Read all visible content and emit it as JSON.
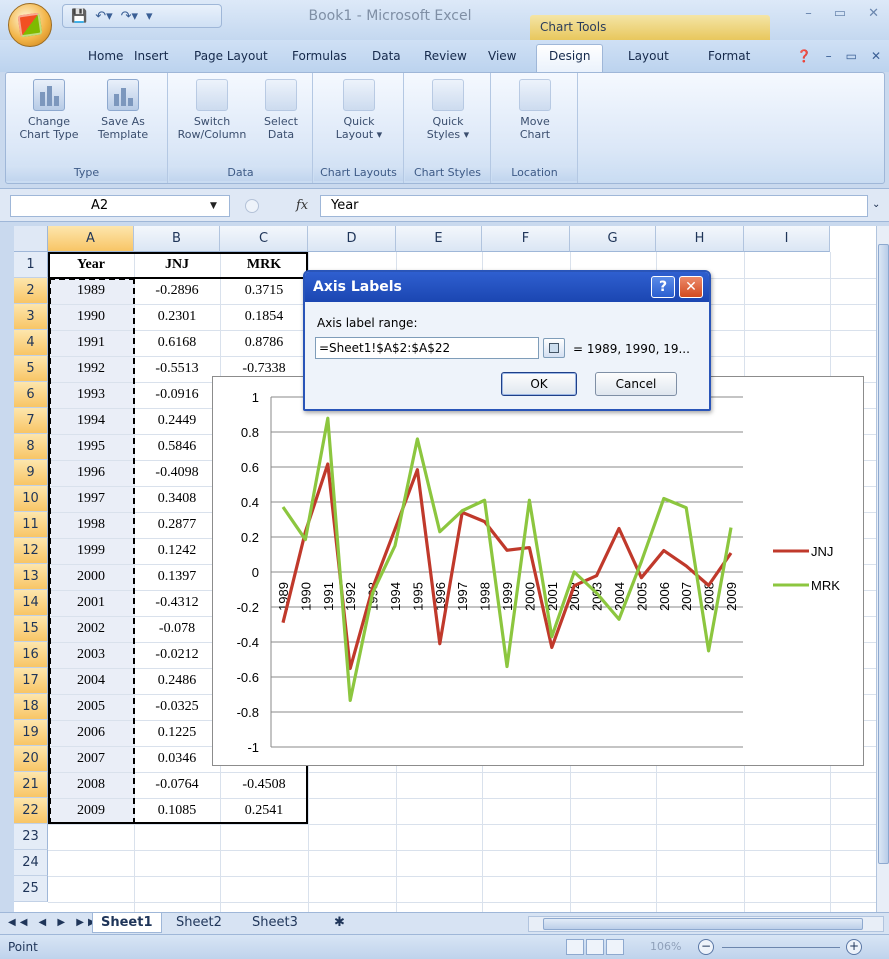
{
  "window": {
    "title": "Book1 - Microsoft Excel",
    "contextual_tab": "Chart Tools"
  },
  "tabs": [
    "Home",
    "Insert",
    "Page Layout",
    "Formulas",
    "Data",
    "Review",
    "View",
    "Design",
    "Layout",
    "Format"
  ],
  "active_tab": "Design",
  "ribbon": {
    "groups": [
      {
        "label": "Type",
        "buttons": [
          "Change\nChart Type",
          "Save As\nTemplate"
        ]
      },
      {
        "label": "Data",
        "buttons": [
          "Switch\nRow/Column",
          "Select\nData"
        ]
      },
      {
        "label": "Chart Layouts",
        "buttons": [
          "Quick\nLayout ▾"
        ]
      },
      {
        "label": "Chart Styles",
        "buttons": [
          "Quick\nStyles ▾"
        ]
      },
      {
        "label": "Location",
        "buttons": [
          "Move\nChart"
        ]
      }
    ]
  },
  "formula_bar": {
    "name_box": "A2",
    "fx": "fx",
    "content": "Year"
  },
  "columns": [
    "A",
    "B",
    "C",
    "D",
    "E",
    "F",
    "G",
    "H",
    "I"
  ],
  "rows": [
    "1",
    "2",
    "3",
    "4",
    "5",
    "6",
    "7",
    "8",
    "9",
    "10",
    "11",
    "12",
    "13",
    "14",
    "15",
    "16",
    "17",
    "18",
    "19",
    "20",
    "21",
    "22",
    "23",
    "24",
    "25"
  ],
  "table": {
    "headers": [
      "Year",
      "JNJ",
      "MRK"
    ],
    "rows": [
      [
        "1989",
        "-0.2896",
        "0.3715"
      ],
      [
        "1990",
        "0.2301",
        "0.1854"
      ],
      [
        "1991",
        "0.6168",
        "0.8786"
      ],
      [
        "1992",
        "-0.5513",
        "-0.7338"
      ],
      [
        "1993",
        "-0.0916",
        ""
      ],
      [
        "1994",
        "0.2449",
        ""
      ],
      [
        "1995",
        "0.5846",
        ""
      ],
      [
        "1996",
        "-0.4098",
        ""
      ],
      [
        "1997",
        "0.3408",
        ""
      ],
      [
        "1998",
        "0.2877",
        ""
      ],
      [
        "1999",
        "0.1242",
        ""
      ],
      [
        "2000",
        "0.1397",
        ""
      ],
      [
        "2001",
        "-0.4312",
        ""
      ],
      [
        "2002",
        "-0.078",
        ""
      ],
      [
        "2003",
        "-0.0212",
        ""
      ],
      [
        "2004",
        "0.2486",
        ""
      ],
      [
        "2005",
        "-0.0325",
        ""
      ],
      [
        "2006",
        "0.1225",
        ""
      ],
      [
        "2007",
        "0.0346",
        "0.3674"
      ],
      [
        "2008",
        "-0.0764",
        "-0.4508"
      ],
      [
        "2009",
        "0.1085",
        "0.2541"
      ]
    ]
  },
  "chart_data": {
    "type": "line",
    "x": [
      "1989",
      "1990",
      "1991",
      "1992",
      "1993",
      "1994",
      "1995",
      "1996",
      "1997",
      "1998",
      "1999",
      "2000",
      "2001",
      "2002",
      "2003",
      "2004",
      "2005",
      "2006",
      "2007",
      "2008",
      "2009"
    ],
    "series": [
      {
        "name": "JNJ",
        "color": "#c0392b",
        "values": [
          -0.2896,
          0.2301,
          0.6168,
          -0.5513,
          -0.0916,
          0.2449,
          0.5846,
          -0.4098,
          0.3408,
          0.2877,
          0.1242,
          0.1397,
          -0.4312,
          -0.078,
          -0.0212,
          0.2486,
          -0.0325,
          0.1225,
          0.0346,
          -0.0764,
          0.1085
        ]
      },
      {
        "name": "MRK",
        "color": "#8cc63f",
        "values": [
          0.3715,
          0.1854,
          0.8786,
          -0.7338,
          -0.12,
          0.15,
          0.76,
          0.23,
          0.35,
          0.41,
          -0.54,
          0.41,
          -0.37,
          0.0,
          -0.12,
          -0.27,
          0.06,
          0.42,
          0.3674,
          -0.4508,
          0.2541
        ]
      }
    ],
    "y_ticks": [
      "1",
      "0.8",
      "0.6",
      "0.4",
      "0.2",
      "0",
      "-0.2",
      "-0.4",
      "-0.6",
      "-0.8",
      "-1"
    ],
    "ylim": [
      -1,
      1
    ],
    "grid": true,
    "legend": "right"
  },
  "dialog": {
    "title": "Axis Labels",
    "help": "?",
    "close": "✕",
    "label": "Axis label range:",
    "value": "=Sheet1!$A$2:$A$22",
    "preview": "= 1989, 1990, 19...",
    "ok": "OK",
    "cancel": "Cancel"
  },
  "sheets": [
    "Sheet1",
    "Sheet2",
    "Sheet3"
  ],
  "active_sheet": "Sheet1",
  "status": {
    "mode": "Point",
    "zoom": "106%"
  }
}
